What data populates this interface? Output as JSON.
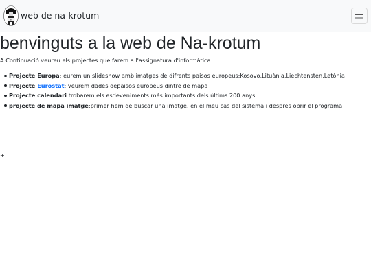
{
  "navbar": {
    "brand_text": "web de na-krotum",
    "logo_icon": "avatar-figure-icon",
    "menu_icon": "hamburger-menu-icon"
  },
  "main": {
    "title": "benvinguts a la web de Na-krotum",
    "intro": "A Continuació veureu els projectes que farem a l'assignatura d'informàtica:",
    "projects": [
      {
        "name": "Projecte Europa",
        "description": ": eurem un slideshow amb imatges de difrents paisos europeus:Kosovo,Lituània,Liechtensten,Letònia"
      },
      {
        "name_prefix": "Projecte ",
        "link_text": "Eurostat",
        "description": ": veurem dades depaisos europeus dintre de mapa"
      },
      {
        "name": "Projecte calendari",
        "description": ":trobarem els esdeveniments més importants dels últims 200 anys"
      },
      {
        "name": "projecte de mapa imatge",
        "description": ":primer hem de buscar una imatge, en el meu cas del sistema i despres obrir el programa"
      }
    ],
    "trailing_symbol": "+"
  },
  "colors": {
    "navbar_bg": "#f8f9fa",
    "text": "#212529",
    "link": "#0d6efd"
  }
}
